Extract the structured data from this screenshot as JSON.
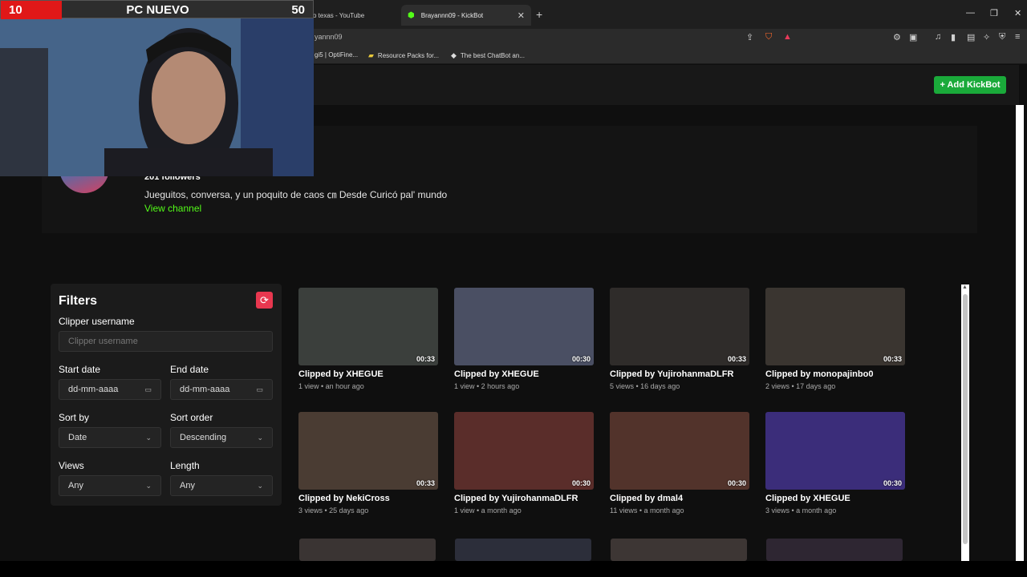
{
  "browser": {
    "tabs": [
      {
        "label": "o texas - YouTube"
      },
      {
        "label": "Brayannn09 - KickBot"
      }
    ],
    "address": "yannn09",
    "bookmarks": [
      {
        "label": "gi5 | OptiFine..."
      },
      {
        "label": "Resource Packs for..."
      },
      {
        "label": "The best ChatBot an..."
      }
    ]
  },
  "webcam": {
    "left_number": "10",
    "title": "PC NUEVO",
    "right_number": "50"
  },
  "header": {
    "add_button": "+ Add KickBot"
  },
  "profile": {
    "followers": "201 followers",
    "bio": "Jueguitos, conversa, y un poquito de caos ㎝ Desde Curicó pal' mundo",
    "view_channel": "View channel"
  },
  "filters": {
    "title": "Filters",
    "clipper_label": "Clipper username",
    "clipper_placeholder": "Clipper username",
    "start_date_label": "Start date",
    "start_date_value": "dd-mm-aaaa",
    "end_date_label": "End date",
    "end_date_value": "dd-mm-aaaa",
    "sort_by_label": "Sort by",
    "sort_by_value": "Date",
    "sort_order_label": "Sort order",
    "sort_order_value": "Descending",
    "views_label": "Views",
    "views_value": "Any",
    "length_label": "Length",
    "length_value": "Any"
  },
  "clips": [
    {
      "by": "Clipped by XHEGUE",
      "meta": "1 view • an hour ago",
      "duration": "00:33",
      "color": "#3b3f3c"
    },
    {
      "by": "Clipped by XHEGUE",
      "meta": "1 view • 2 hours ago",
      "duration": "00:30",
      "color": "#4a4f63"
    },
    {
      "by": "Clipped by YujirohanmaDLFR",
      "meta": "5 views • 16 days ago",
      "duration": "00:33",
      "color": "#2f2c2a"
    },
    {
      "by": "Clipped by monopajinbo0",
      "meta": "2 views • 17 days ago",
      "duration": "00:33",
      "color": "#3a3530"
    },
    {
      "by": "Clipped by NekiCross",
      "meta": "3 views • 25 days ago",
      "duration": "00:33",
      "color": "#4a3c33"
    },
    {
      "by": "Clipped by YujirohanmaDLFR",
      "meta": "1 view • a month ago",
      "duration": "00:30",
      "color": "#5a2d2a"
    },
    {
      "by": "Clipped by dmal4",
      "meta": "11 views • a month ago",
      "duration": "00:30",
      "color": "#52332b"
    },
    {
      "by": "Clipped by XHEGUE",
      "meta": "3 views • a month ago",
      "duration": "00:30",
      "color": "#3b2d7a"
    }
  ],
  "colors": {
    "accent_green": "#53fc18",
    "button_green": "#1aaa3a",
    "reset_red": "#e8374f"
  }
}
